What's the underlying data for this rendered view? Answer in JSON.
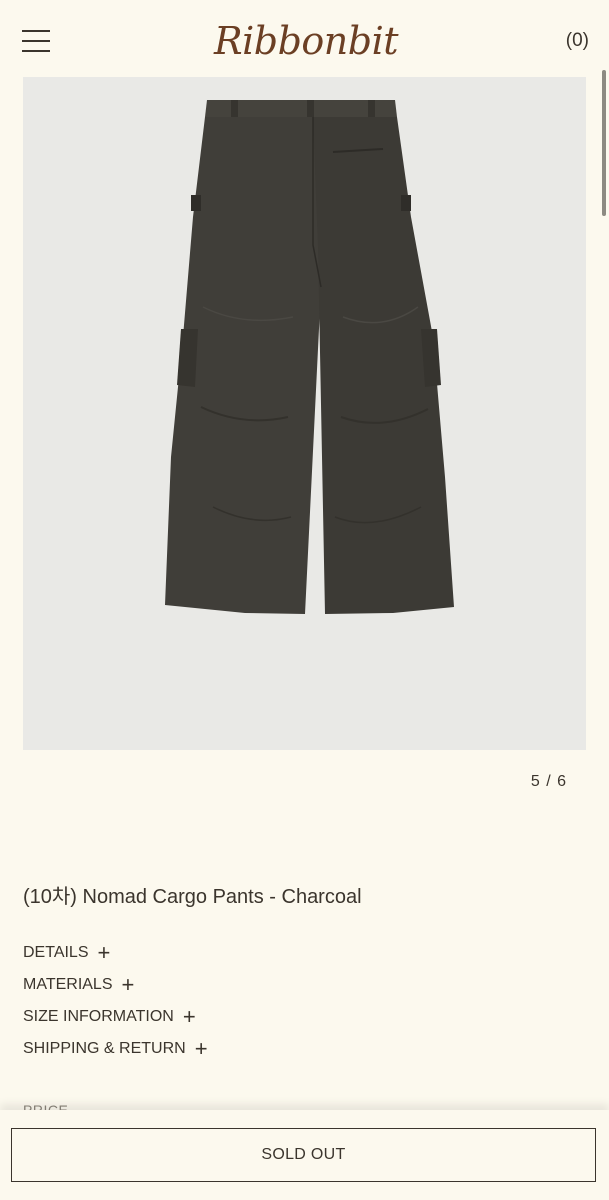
{
  "header": {
    "brand": "Ribbonbit",
    "cart_label": "(0)",
    "menu_icon": "hamburger-menu-icon"
  },
  "gallery": {
    "counter": "5 / 6",
    "image_alt": "Nomad Cargo Pants - Charcoal, back view"
  },
  "product": {
    "title": "(10차) Nomad Cargo Pants - Charcoal"
  },
  "accordion": [
    {
      "label": "DETAILS",
      "icon": "+"
    },
    {
      "label": "MATERIALS",
      "icon": "+"
    },
    {
      "label": "SIZE INFORMATION",
      "icon": "+"
    },
    {
      "label": "SHIPPING & RETURN",
      "icon": "+"
    }
  ],
  "price": {
    "label": "PRICE"
  },
  "actions": {
    "sold_out_label": "SOLD OUT"
  },
  "colors": {
    "background": "#fcf9ee",
    "text": "#3b352d",
    "brand": "#6b3f24",
    "image_bg": "#e9e9e6",
    "pants": "#3e3c37"
  }
}
